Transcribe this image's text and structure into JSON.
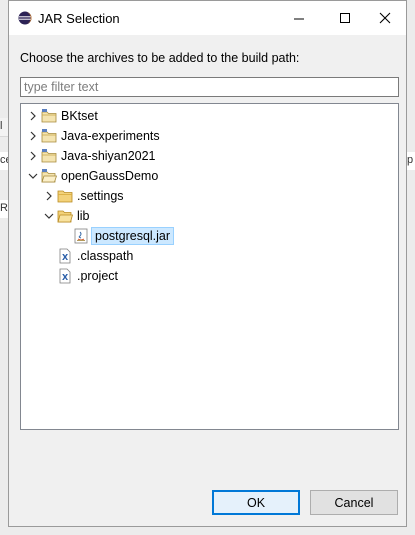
{
  "window": {
    "title": "JAR Selection"
  },
  "background": {
    "fragments": [
      "l",
      "ce",
      "RE",
      "p"
    ]
  },
  "message": "Choose the archives to be added to the build path:",
  "filter": {
    "placeholder": "type filter text",
    "value": ""
  },
  "tree": {
    "items": [
      {
        "label": "BKtset",
        "type": "project",
        "expanded": false,
        "depth": 0
      },
      {
        "label": "Java-experiments",
        "type": "project",
        "expanded": false,
        "depth": 0
      },
      {
        "label": "Java-shiyan2021",
        "type": "project",
        "expanded": false,
        "depth": 0
      },
      {
        "label": "openGaussDemo",
        "type": "project",
        "expanded": true,
        "depth": 0
      },
      {
        "label": ".settings",
        "type": "folder",
        "expanded": false,
        "depth": 1
      },
      {
        "label": "lib",
        "type": "folder",
        "expanded": true,
        "depth": 1
      },
      {
        "label": "postgresql.jar",
        "type": "jar",
        "selected": true,
        "depth": 2
      },
      {
        "label": ".classpath",
        "type": "xml-file",
        "depth": 1
      },
      {
        "label": ".project",
        "type": "xml-file",
        "depth": 1
      }
    ]
  },
  "buttons": {
    "ok": "OK",
    "cancel": "Cancel"
  },
  "icons": {
    "app": "eclipse-icon",
    "minimize": "minimize-icon",
    "maximize": "maximize-icon",
    "close": "close-icon"
  }
}
